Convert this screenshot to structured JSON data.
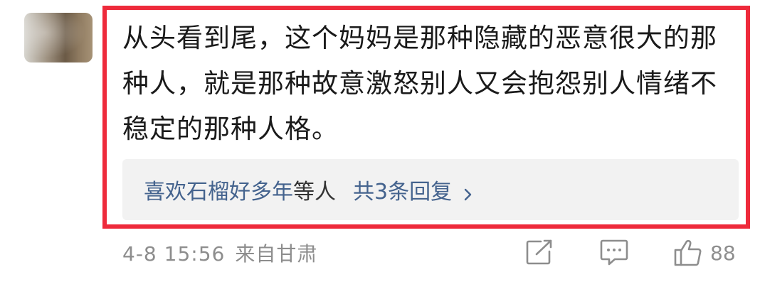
{
  "comment": {
    "text": "从头看到尾，这个妈妈是那种隐藏的恶意很大的那种人，就是那种故意激怒别人又会抱怨别人情绪不稳定的那种人格。",
    "date": "4-8 15:56",
    "location": "来自甘肃",
    "likes": "88"
  },
  "replies": {
    "user": "喜欢石榴好多年",
    "suffix": "等人",
    "count_label": "共3条回复"
  },
  "icons": {
    "share": "share-edit-icon",
    "comment": "comment-icon",
    "like": "thumbs-up-icon",
    "chevron": "chevron-right-icon"
  },
  "colors": {
    "highlight_border": "#ee2a3b",
    "link": "#44638e",
    "meta": "#8d8d8d"
  }
}
